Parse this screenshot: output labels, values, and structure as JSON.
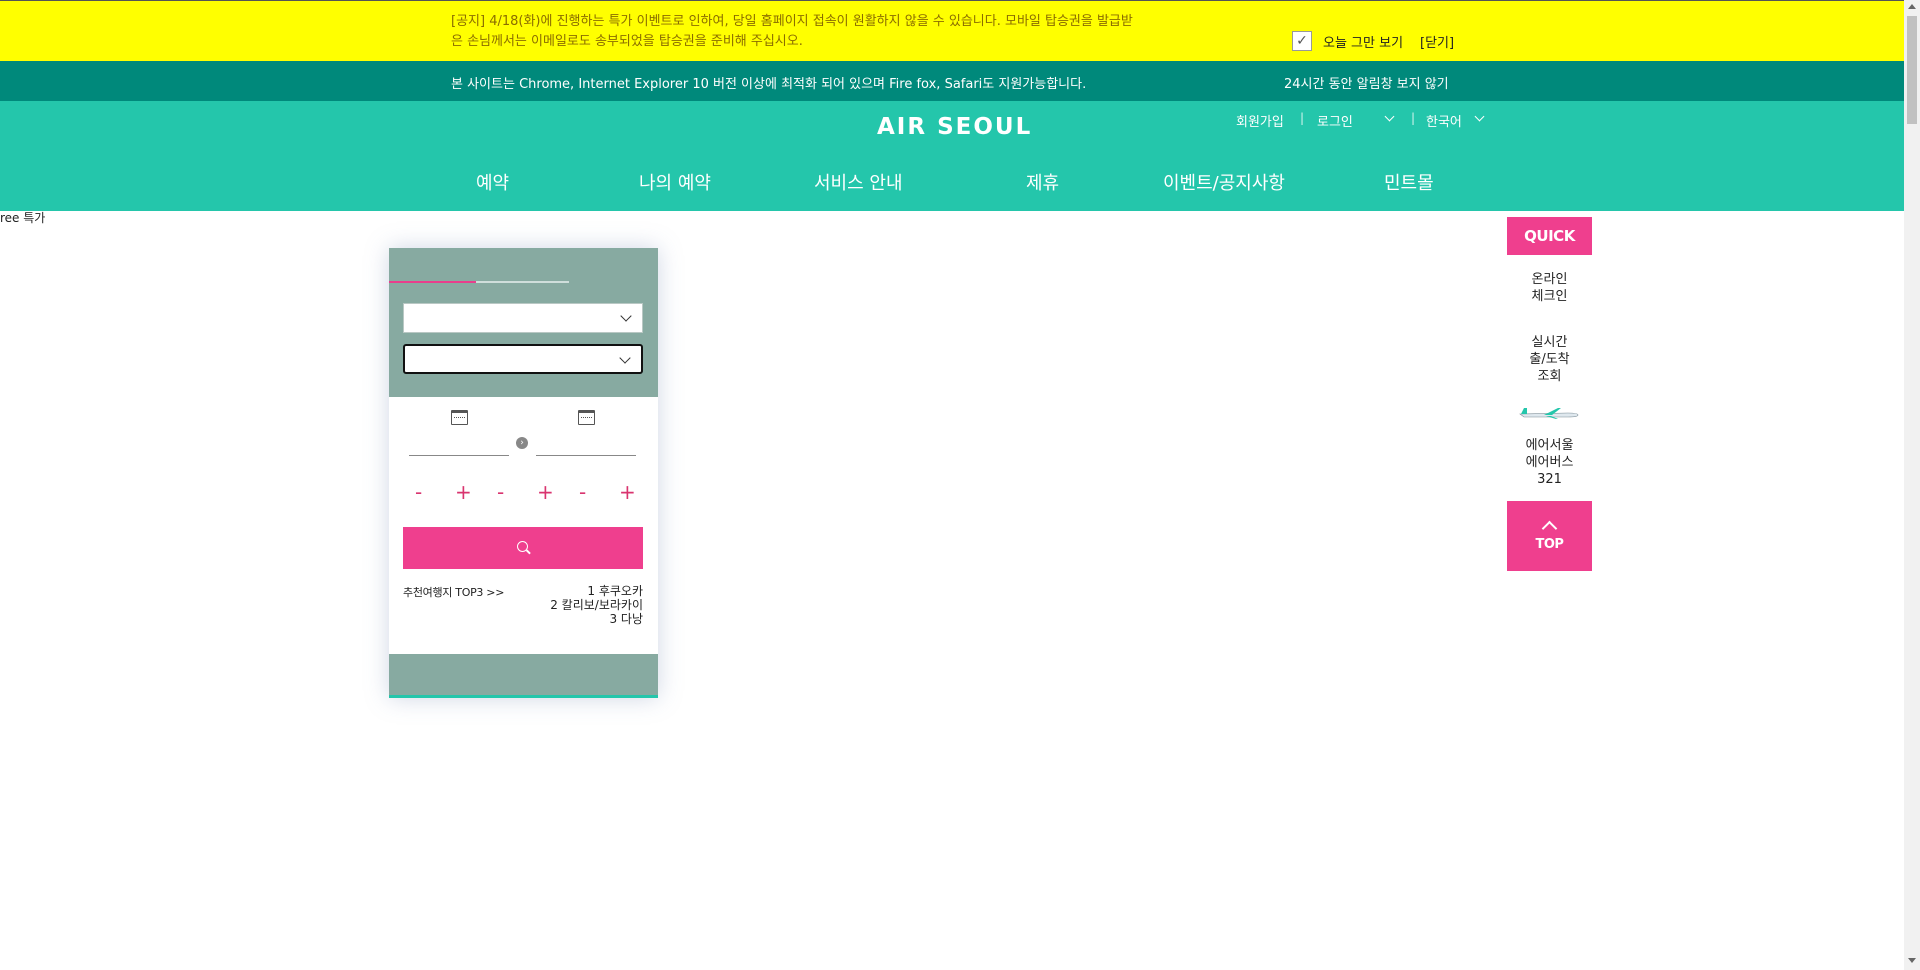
{
  "notice": {
    "line1": "[공지] 4/18(화)에 진행하는 특가 이벤트로 인하여, 당일 홈페이지 접속이 원활하지 않을 수 있습니다. 모바일 탑승권을 발급받",
    "line2": "은 손님께서는 이메일로도 송부되었을 탑승권을 준비해 주십시오.",
    "dont_show_today": "오늘 그만 보기",
    "close": "[닫기]"
  },
  "browser_notice": {
    "text": "본 사이트는 Chrome, Internet Explorer 10 버전 이상에 최적화 되어 있으며 Fire fox, Safari도 지원가능합니다.",
    "hide_24h": "24시간 동안 알림창 보지 않기"
  },
  "header": {
    "logo": "AIR SEOUL",
    "util": {
      "signup": "회원가입",
      "login": "로그인",
      "language": "한국어",
      "separator": "|"
    },
    "nav": [
      "예약",
      "나의 예약",
      "서비스 안내",
      "제휴",
      "이벤트/공지사항",
      "민트몰"
    ]
  },
  "stray_text": "ree 특가",
  "booking": {
    "pax_controls": {
      "minus": "-",
      "plus": "+"
    },
    "top3_title": "추천여행지 TOP3 >>",
    "top3": [
      "1  후쿠오카",
      "2  칼리보/보라카이",
      "3  다낭"
    ],
    "arrow": "›"
  },
  "quick_menu": {
    "title": "QUICK",
    "items": {
      "checkin": [
        "온라인",
        "체크인"
      ],
      "status": [
        "실시간",
        "출/도착",
        "조회"
      ],
      "aircraft": [
        "에어서울",
        "에어버스",
        "321"
      ]
    },
    "top": "TOP"
  },
  "colors": {
    "notice_bg": "#ffff00",
    "browserbar_bg": "#00897b",
    "header_bg": "#24c6ab",
    "accent_pink": "#ef3f8e",
    "widget_gray": "#87aaa1"
  }
}
